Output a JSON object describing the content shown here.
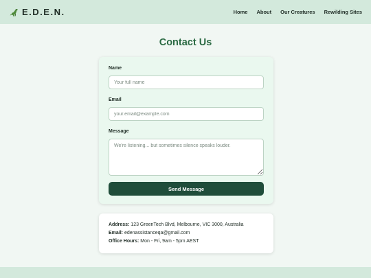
{
  "brand": {
    "name": "E.D.E.N.",
    "logo_icon": "dinosaur-icon"
  },
  "nav": {
    "items": [
      {
        "label": "Home"
      },
      {
        "label": "About"
      },
      {
        "label": "Our Creatures"
      },
      {
        "label": "Rewilding Sites"
      }
    ]
  },
  "page": {
    "title": "Contact Us"
  },
  "form": {
    "name_label": "Name",
    "name_placeholder": "Your full name",
    "email_label": "Email",
    "email_placeholder": "your.email@example.com",
    "message_label": "Message",
    "message_placeholder": "We're listening... but sometimes silence speaks louder.",
    "submit_label": "Send Message"
  },
  "contact_info": {
    "address_key": "Address:",
    "address_value": "123 GreenTech Blvd, Melbourne, VIC 3000, Australia",
    "email_key": "Email:",
    "email_value": "edenassistanceqa@gmail.com",
    "hours_key": "Office Hours:",
    "hours_value": "Mon - Fri, 9am - 5pm AEST"
  },
  "colors": {
    "header_bg": "#d3e9dc",
    "page_bg": "#f1f7f3",
    "title": "#2b6a43",
    "button": "#1f4d3a",
    "form_card_bg": "#eaf8ef",
    "logo_green": "#4f8a3a"
  }
}
